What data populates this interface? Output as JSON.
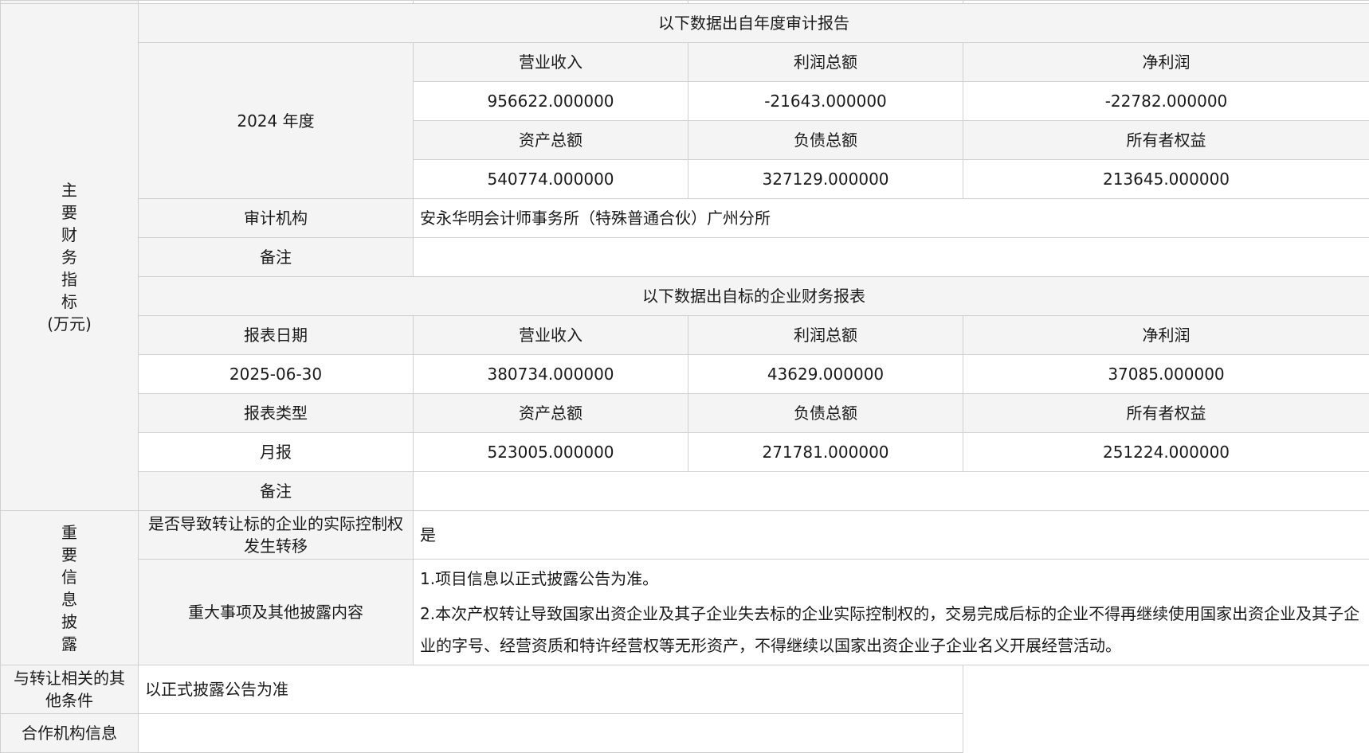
{
  "financials": {
    "section_label_chars": [
      "主",
      "要",
      "财",
      "务",
      "指",
      "标"
    ],
    "section_label_unit": "(万元)",
    "audit_header": "以下数据出自年度审计报告",
    "audit_year": "2024 年度",
    "audit_headers_row1": [
      "营业收入",
      "利润总额",
      "净利润"
    ],
    "audit_values_row1": [
      "956622.000000",
      "-21643.000000",
      "-22782.000000"
    ],
    "audit_headers_row2": [
      "资产总额",
      "负债总额",
      "所有者权益"
    ],
    "audit_values_row2": [
      "540774.000000",
      "327129.000000",
      "213645.000000"
    ],
    "audit_org_label": "审计机构",
    "audit_org_value": "安永华明会计师事务所（特殊普通合伙）广州分所",
    "remark_label": "备注",
    "remark_value": "",
    "report_header": "以下数据出自标的企业财务报表",
    "report_date_label": "报表日期",
    "report_headers_row1": [
      "营业收入",
      "利润总额",
      "净利润"
    ],
    "report_date_value": "2025-06-30",
    "report_values_row1": [
      "380734.000000",
      "43629.000000",
      "37085.000000"
    ],
    "report_type_label": "报表类型",
    "report_headers_row2": [
      "资产总额",
      "负债总额",
      "所有者权益"
    ],
    "report_type_value": "月报",
    "report_values_row2": [
      "523005.000000",
      "271781.000000",
      "251224.000000"
    ],
    "report_remark_label": "备注",
    "report_remark_value": ""
  },
  "disclosure": {
    "section_label_chars": [
      "重",
      "要",
      "信",
      "息",
      "披",
      "露"
    ],
    "control_change_label": "是否导致转让标的企业的实际控制权发生转移",
    "control_change_value": "是",
    "major_items_label": "重大事项及其他披露内容",
    "major_items_lines": [
      "1.项目信息以正式披露公告为准。",
      "2.本次产权转让导致国家出资企业及其子企业失去标的企业实际控制权的，交易完成后标的企业不得再继续使用国家出资企业及其子企业的字号、经营资质和特许经营权等无形资产，不得继续以国家出资企业子企业名义开展经营活动。"
    ]
  },
  "other_conditions": {
    "label": "与转让相关的其他条件",
    "value": "以正式披露公告为准"
  },
  "partner_org": {
    "label": "合作机构信息",
    "value": ""
  }
}
